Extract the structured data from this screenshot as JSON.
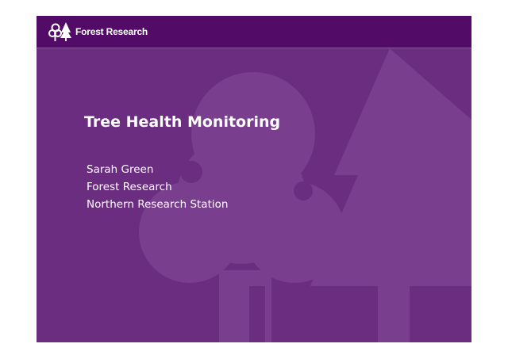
{
  "brand": {
    "logo_text": "Forest Research",
    "logo_icon": "tree-logo-icon"
  },
  "colors": {
    "slide_background": "#6a2d80",
    "header_background": "#520c68",
    "watermark": "#7a3e8f",
    "text": "#ffffff"
  },
  "slide": {
    "title": "Tree Health Monitoring",
    "presenter_name": "Sarah Green",
    "organisation": "Forest Research",
    "location": "Northern Research Station"
  }
}
